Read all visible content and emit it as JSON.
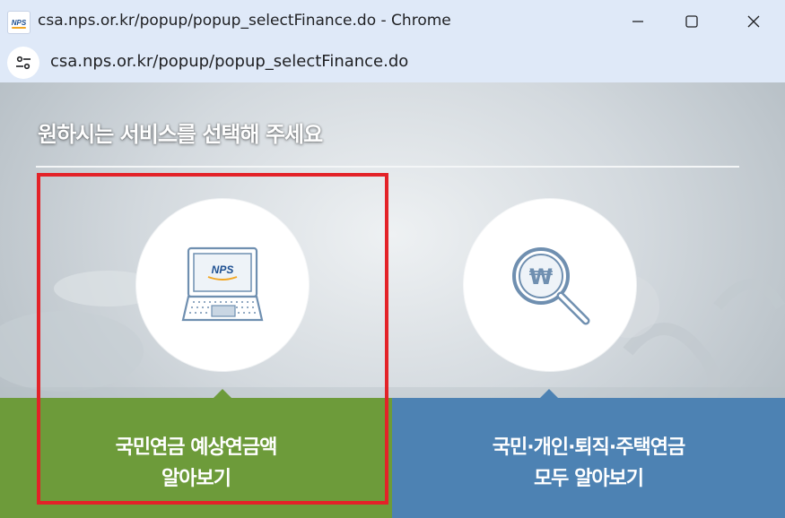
{
  "window": {
    "title": "csa.nps.or.kr/popup/popup_selectFinance.do - Chrome",
    "favicon_icon": "nps-logo-icon",
    "favicon_text": "NPS",
    "controls": [
      "minimize-icon",
      "maximize-icon",
      "close-icon"
    ]
  },
  "addressbar": {
    "site_info_icon": "site-settings-icon",
    "url": "csa.nps.or.kr/popup/popup_selectFinance.do"
  },
  "page": {
    "heading": "원하시는 서비스를 선택해 주세요",
    "options": [
      {
        "line1": "국민연금 예상연금액",
        "line2": "알아보기",
        "icon": "laptop-nps-icon",
        "icon_text": "NPS",
        "color": "#6d9b3a",
        "highlighted": true
      },
      {
        "line1": "국민·개인·퇴직·주택연금",
        "line2": "모두 알아보기",
        "icon": "won-magnifier-icon",
        "icon_text": "₩",
        "color": "#4d82b3",
        "highlighted": false
      }
    ],
    "highlight_color": "#e32228"
  }
}
